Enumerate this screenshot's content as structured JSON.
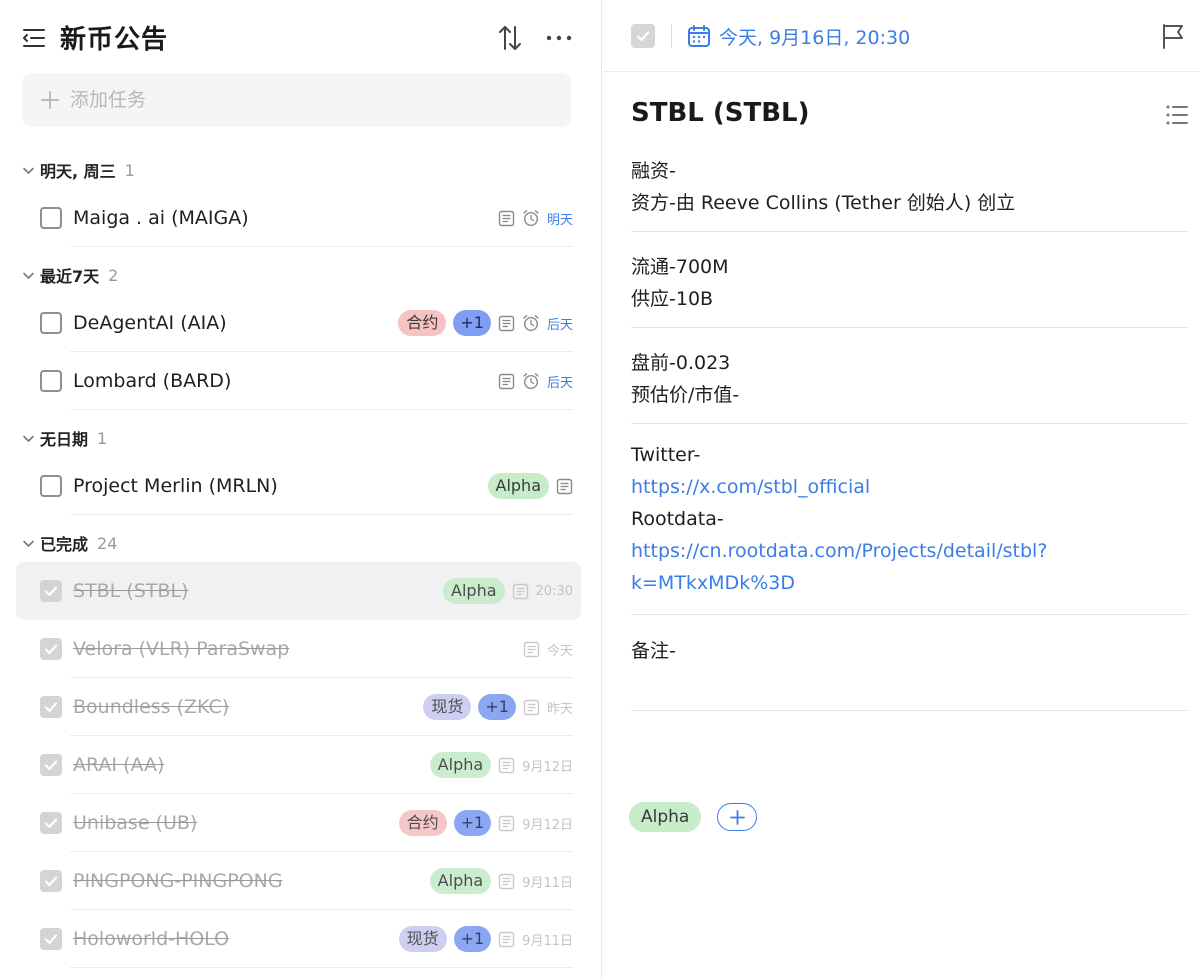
{
  "list": {
    "title": "新币公告",
    "add_task_placeholder": "添加任务"
  },
  "sections": [
    {
      "name": "明天, 周三",
      "count": "1",
      "tasks": [
        {
          "title": "Maiga . ai (MAIGA)",
          "tags": [],
          "note": true,
          "reminder": true,
          "date": "明天",
          "done": false
        }
      ]
    },
    {
      "name": "最近7天",
      "count": "2",
      "tasks": [
        {
          "title": "DeAgentAI (AIA)",
          "tags": [
            {
              "label": "合约",
              "kind": "heyue"
            },
            {
              "label": "+1",
              "kind": "plus1"
            }
          ],
          "note": true,
          "reminder": true,
          "date": "后天",
          "done": false
        },
        {
          "title": "Lombard (BARD)",
          "tags": [],
          "note": true,
          "reminder": true,
          "date": "后天",
          "done": false
        }
      ]
    },
    {
      "name": "无日期",
      "count": "1",
      "tasks": [
        {
          "title": "Project Merlin (MRLN)",
          "tags": [
            {
              "label": "Alpha",
              "kind": "alpha"
            }
          ],
          "note": true,
          "reminder": false,
          "date": "",
          "done": false
        }
      ]
    },
    {
      "name": "已完成",
      "count": "24",
      "tasks": [
        {
          "title": "STBL (STBL)",
          "tags": [
            {
              "label": "Alpha",
              "kind": "alpha"
            }
          ],
          "note": true,
          "reminder": false,
          "date": "20:30",
          "done": true,
          "selected": true
        },
        {
          "title": "Velora (VLR) ParaSwap",
          "tags": [],
          "note": true,
          "reminder": false,
          "date": "今天",
          "done": true
        },
        {
          "title": "Boundless (ZKC)",
          "tags": [
            {
              "label": "现货",
              "kind": "xianhuo"
            },
            {
              "label": "+1",
              "kind": "plus1"
            }
          ],
          "note": true,
          "reminder": false,
          "date": "昨天",
          "done": true
        },
        {
          "title": "ARAI (AA)",
          "tags": [
            {
              "label": "Alpha",
              "kind": "alpha"
            }
          ],
          "note": true,
          "reminder": false,
          "date": "9月12日",
          "done": true
        },
        {
          "title": "Unibase (UB)",
          "tags": [
            {
              "label": "合约",
              "kind": "heyue"
            },
            {
              "label": "+1",
              "kind": "plus1"
            }
          ],
          "note": true,
          "reminder": false,
          "date": "9月12日",
          "done": true
        },
        {
          "title": "PINGPONG-PINGPONG",
          "tags": [
            {
              "label": "Alpha",
              "kind": "alpha"
            }
          ],
          "note": true,
          "reminder": false,
          "date": "9月11日",
          "done": true
        },
        {
          "title": "Holoworld-HOLO",
          "tags": [
            {
              "label": "现货",
              "kind": "xianhuo"
            },
            {
              "label": "+1",
              "kind": "plus1"
            }
          ],
          "note": true,
          "reminder": false,
          "date": "9月11日",
          "done": true
        }
      ]
    }
  ],
  "detail": {
    "date": "今天, 9月16日, 20:30",
    "title": "STBL (STBL)",
    "funding_line": "融资-",
    "backer_line": "资方-由 Reeve Collins (Tether 创始人) 创立",
    "circulation_line": "流通-700M",
    "supply_line": "供应-10B",
    "premarket_line": "盘前-0.023",
    "valuation_line": "预估价/市值-",
    "twitter_label": "Twitter-",
    "twitter_url": "https://x.com/stbl_official",
    "rootdata_label": "Rootdata-",
    "rootdata_url_line1": "https://cn.rootdata.com/Projects/detail/stbl?",
    "rootdata_url_line2": "k=MTkxMDk%3D",
    "notes_label": "备注-",
    "tag": "Alpha"
  },
  "colors": {
    "accent": "#3b7de8",
    "alpha_tag": "#c6ecca",
    "heyue_tag": "#f6c2c2",
    "xianhuo_tag": "#c9c9f2",
    "plus1_tag": "#7f9df2"
  },
  "icons": [
    "menu-collapse-icon",
    "sort-icon",
    "more-icon",
    "plus-icon",
    "chevron-down-icon",
    "note-icon",
    "alarm-clock-icon",
    "calendar-icon",
    "flag-icon",
    "list-icon",
    "checkmark-icon"
  ]
}
